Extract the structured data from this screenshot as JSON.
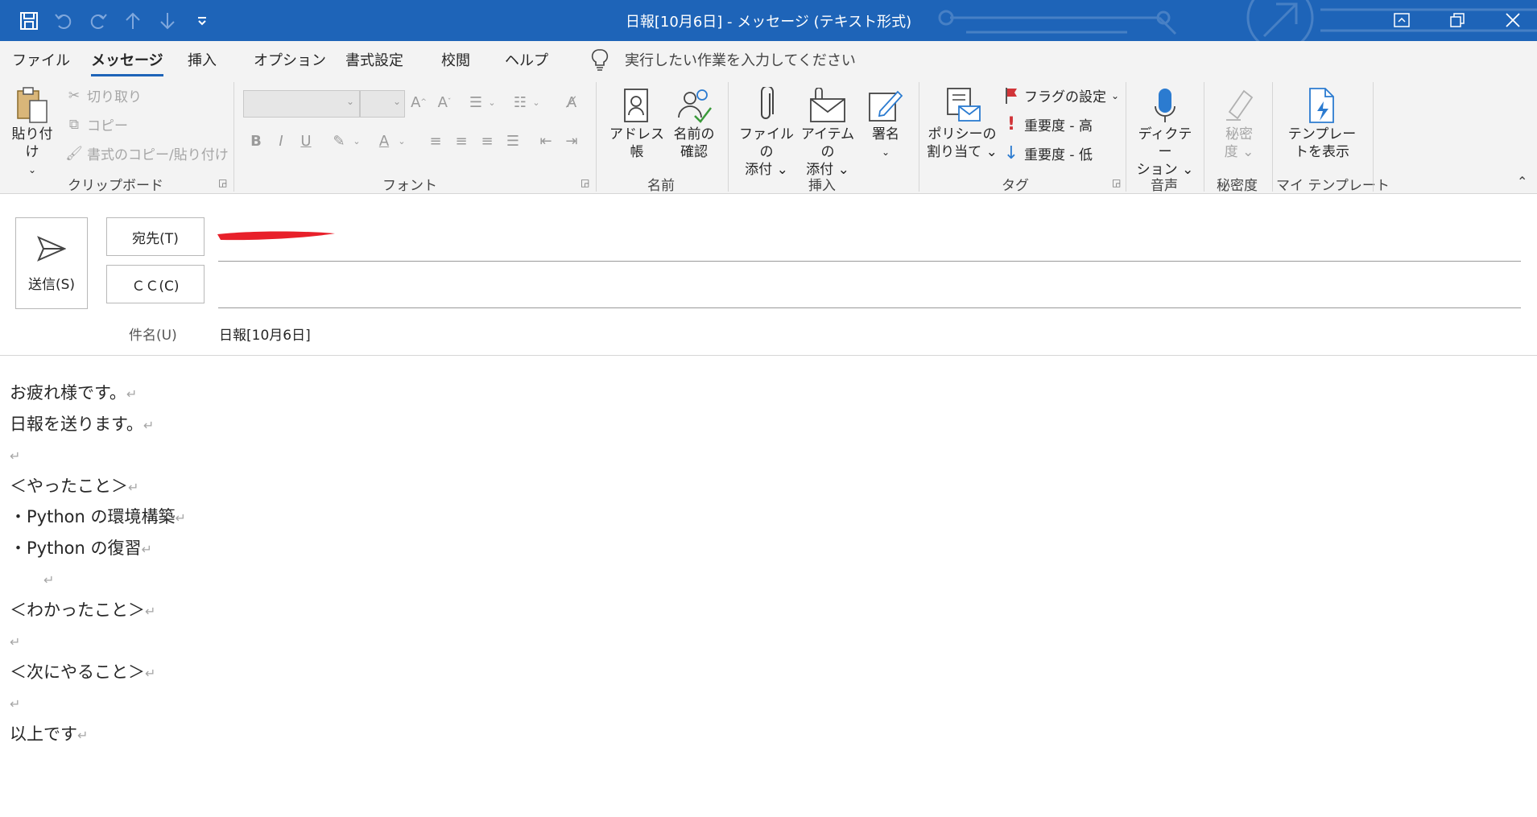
{
  "window": {
    "title": "日報[10月6日]  -  メッセージ (テキスト形式)"
  },
  "tabs": [
    {
      "label": "ファイル"
    },
    {
      "label": "メッセージ"
    },
    {
      "label": "挿入"
    },
    {
      "label": "オプション"
    },
    {
      "label": "書式設定"
    },
    {
      "label": "校閲"
    },
    {
      "label": "ヘルプ"
    }
  ],
  "tell_me": "実行したい作業を入力してください",
  "ribbon": {
    "clipboard": {
      "paste": "貼り付け",
      "cut": "切り取り",
      "copy": "コピー",
      "format_painter": "書式のコピー/貼り付け",
      "label": "クリップボード"
    },
    "font": {
      "label": "フォント"
    },
    "names": {
      "address_book": "アドレス帳",
      "check_names_1": "名前の",
      "check_names_2": "確認",
      "label": "名前"
    },
    "insert": {
      "attach_file_1": "ファイルの",
      "attach_file_2": "添付",
      "attach_item_1": "アイテムの",
      "attach_item_2": "添付",
      "signature": "署名",
      "label": "挿入"
    },
    "tags": {
      "policy_1": "ポリシーの",
      "policy_2": "割り当て",
      "follow_up": "フラグの設定",
      "high": "重要度 - 高",
      "low": "重要度 - 低",
      "label": "タグ"
    },
    "voice": {
      "dictate_1": "ディクテー",
      "dictate_2": "ション",
      "label": "音声"
    },
    "sensitivity": {
      "btn_1": "秘密",
      "btn_2": "度",
      "label": "秘密度"
    },
    "templates": {
      "btn_1": "テンプレー",
      "btn_2": "トを表示",
      "label": "マイ テンプレート"
    }
  },
  "compose": {
    "send": "送信(S)",
    "to_button": "宛先(T)",
    "cc_button": "ＣＣ(C)",
    "subject_label": "件名(U)",
    "subject_value": "日報[10月6日]"
  },
  "body_lines": [
    "お疲れ様です。",
    "日報を送ります。",
    "",
    "＜やったこと＞",
    "・Python の環境構築",
    "・Python の復習",
    "　　",
    "＜わかったこと＞",
    "",
    "＜次にやること＞",
    "",
    "以上です"
  ],
  "colors": {
    "accent": "#1e64b8",
    "ribbon_bg": "#f3f3f3",
    "redaction": "#e8202a",
    "flag": "#d13438",
    "arrow_low": "#2b7bd0"
  }
}
